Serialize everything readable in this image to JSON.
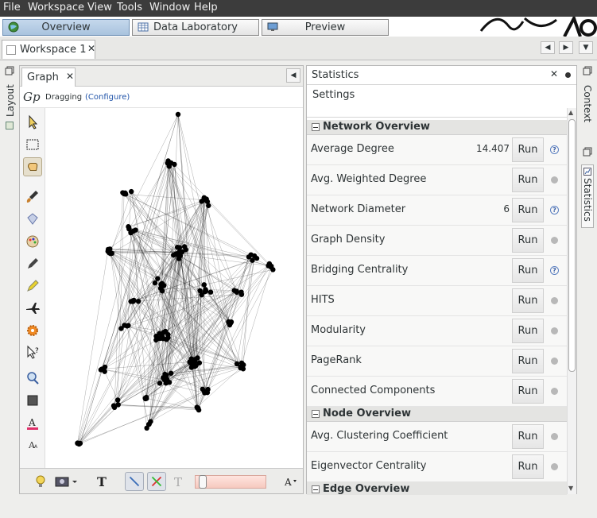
{
  "menu": [
    "File",
    "Workspace",
    "View",
    "Tools",
    "Window",
    "Help"
  ],
  "top_buttons": [
    {
      "label": "Overview",
      "icon": "globe-icon",
      "active": true
    },
    {
      "label": "Data Laboratory",
      "icon": "table-icon",
      "active": false
    },
    {
      "label": "Preview",
      "icon": "monitor-icon",
      "active": false
    }
  ],
  "workspace": {
    "tab_label": "Workspace 1",
    "close": "✕"
  },
  "nav": {
    "left": "◀",
    "right": "▶",
    "down": "▼"
  },
  "left_strip": {
    "label": "Layout"
  },
  "graph_panel": {
    "tab_label": "Graph",
    "close": "✕",
    "logo": "Gp",
    "mode_label": "Dragging",
    "configure_label": "(Configure)",
    "collapse": "◀"
  },
  "stats_panel": {
    "title": "Statistics",
    "close": "✕",
    "settings_label": "Settings",
    "run_label": "Run",
    "sections": [
      {
        "title": "Network Overview",
        "items": [
          {
            "name": "Average Degree",
            "value": "14.407",
            "status": "info"
          },
          {
            "name": "Avg. Weighted Degree",
            "value": "",
            "status": "dot"
          },
          {
            "name": "Network Diameter",
            "value": "6",
            "status": "info"
          },
          {
            "name": "Graph Density",
            "value": "",
            "status": "dot"
          },
          {
            "name": "Bridging Centrality",
            "value": "",
            "status": "info"
          },
          {
            "name": "HITS",
            "value": "",
            "status": "dot"
          },
          {
            "name": "Modularity",
            "value": "",
            "status": "dot"
          },
          {
            "name": "PageRank",
            "value": "",
            "status": "dot"
          },
          {
            "name": "Connected Components",
            "value": "",
            "status": "dot"
          }
        ]
      },
      {
        "title": "Node Overview",
        "items": [
          {
            "name": "Avg. Clustering Coefficient",
            "value": "",
            "status": "dot"
          },
          {
            "name": "Eigenvector Centrality",
            "value": "",
            "status": "dot"
          }
        ]
      },
      {
        "title": "Edge Overview",
        "items": []
      }
    ]
  },
  "right_strip": {
    "context_label": "Context",
    "statistics_label": "Statistics"
  }
}
